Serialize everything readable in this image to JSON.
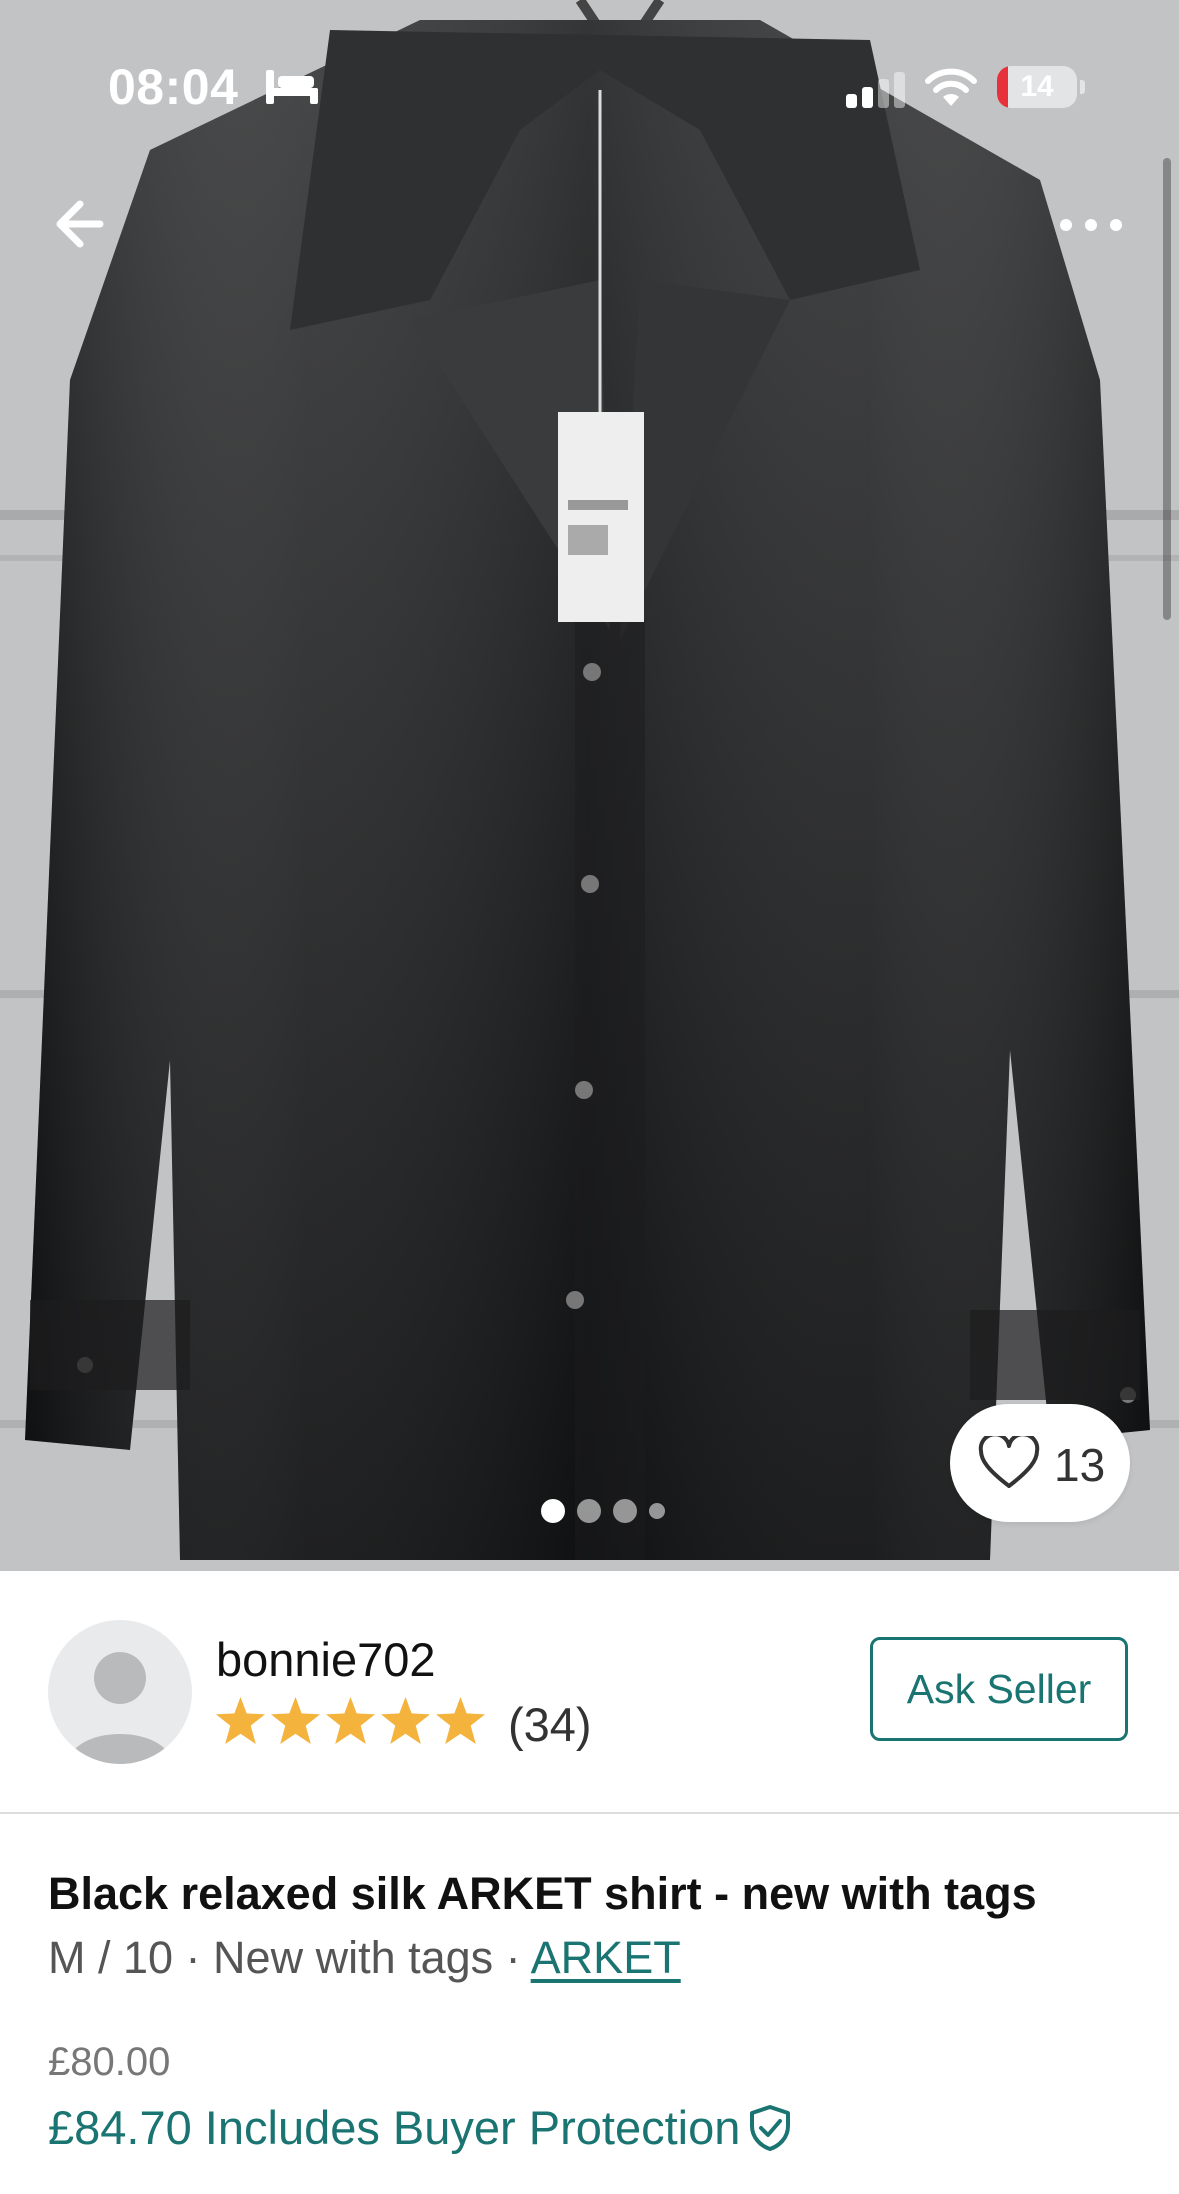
{
  "status_bar": {
    "time": "08:04",
    "battery_level": "14",
    "icons": [
      "sleep-mode-bed-icon",
      "cellular-signal-icon",
      "wifi-icon",
      "battery-icon"
    ]
  },
  "nav": {
    "back_icon": "arrow-left-icon",
    "more_icon": "ellipsis-horizontal-icon"
  },
  "gallery": {
    "image_count": 4,
    "active_index": 0,
    "favourite_count": "13",
    "favourite_icon": "heart-outline-icon"
  },
  "seller": {
    "username": "bonnie702",
    "rating_stars": 5,
    "review_count": "(34)",
    "ask_button_label": "Ask Seller"
  },
  "item": {
    "title": "Black relaxed silk ARKET shirt - new with tags",
    "size": "M / 10",
    "separator": " · ",
    "condition": "New with tags",
    "brand": "ARKET",
    "price": "£80.00",
    "total_price_label": "£84.70 Includes Buyer Protection",
    "protection_icon": "shield-check-icon"
  },
  "colors": {
    "accent": "#1a7471",
    "star": "#f3b33d",
    "battery_low": "#e8323b"
  }
}
